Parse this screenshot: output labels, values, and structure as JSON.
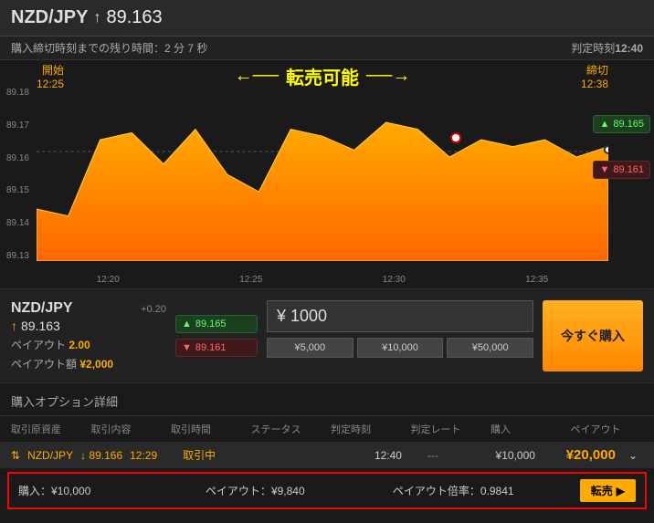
{
  "header": {
    "pair": "NZD/JPY",
    "arrow": "↑",
    "rate": "89.163"
  },
  "subheader": {
    "countdown": "購入締切時刻までの残り時間：2 分 7 秒",
    "judge_label": "判定時刻",
    "judge_time": "12:40"
  },
  "chart": {
    "anno_start_label": "開始",
    "anno_start_time": "12:25",
    "anno_center": "転売可能",
    "anno_end_label": "締切",
    "anno_end_time": "12:38",
    "y_ticks": [
      "89.18",
      "89.17",
      "89.16",
      "89.15",
      "89.14",
      "89.13"
    ],
    "x_ticks": [
      "12:20",
      "12:25",
      "12:30",
      "12:35"
    ],
    "price_up": "89.165",
    "price_down": "89.161"
  },
  "chart_data": {
    "type": "area",
    "title": "",
    "xlabel": "",
    "ylabel": "",
    "ylim": [
      89.13,
      89.18
    ],
    "x": [
      "12:18",
      "12:19",
      "12:20",
      "12:21",
      "12:22",
      "12:23",
      "12:24",
      "12:25",
      "12:26",
      "12:27",
      "12:28",
      "12:29",
      "12:30",
      "12:31",
      "12:32",
      "12:33",
      "12:34",
      "12:35",
      "12:36"
    ],
    "values": [
      89.145,
      89.143,
      89.165,
      89.167,
      89.158,
      89.168,
      89.155,
      89.15,
      89.168,
      89.166,
      89.162,
      89.17,
      89.168,
      89.16,
      89.165,
      89.163,
      89.165,
      89.16,
      89.163
    ]
  },
  "order": {
    "pair": "NZD/JPY",
    "delta": "+0.20",
    "rate": "89.163",
    "payout_label": "ペイアウト",
    "payout_val": "2.00",
    "payout_amt_label": "ペイアウト額",
    "payout_amt": "¥2,000",
    "price_up": "89.165",
    "price_down": "89.161",
    "amount": "¥ 1000",
    "presets": [
      "¥5,000",
      "¥10,000",
      "¥50,000"
    ],
    "buy_now": "今すぐ購入"
  },
  "details": {
    "header": "購入オプション詳細",
    "cols": [
      "取引原資産",
      "取引内容",
      "取引時間",
      "ステータス",
      "判定時刻",
      "判定レート",
      "購入",
      "ペイアウト"
    ]
  },
  "position": {
    "pair": "NZD/JPY",
    "dir": "↓",
    "rate": "89.166",
    "time": "12:29",
    "status": "取引中",
    "judge": "12:40",
    "dash": "---",
    "buy": "¥10,000",
    "payout": "¥20,000"
  },
  "resell": {
    "buy_label": "購入：",
    "buy_val": "¥10,000",
    "payout_label": "ペイアウト：",
    "payout_val": "¥9,840",
    "ratio_label": "ペイアウト倍率：",
    "ratio_val": "0.9841",
    "btn": "転売"
  }
}
